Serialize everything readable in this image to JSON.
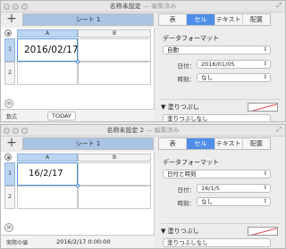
{
  "windows": [
    {
      "title": "名称未設定",
      "title_suffix": " — 編集済み",
      "sheet_tab": "シート 1",
      "inspector_tabs": [
        "表",
        "セル",
        "テキスト",
        "配置"
      ],
      "active_tab": "セル",
      "columns": [
        "A",
        "B"
      ],
      "rows": [
        "1",
        "2"
      ],
      "cell_a1": "2016/02/17",
      "formula_label": "数式",
      "formula_value": "TODAY",
      "data_format_title": "データフォーマット",
      "format_select": "自動",
      "date_label": "日付：",
      "date_value": "2016/01/05",
      "time_label": "時刻：",
      "time_value": "なし",
      "fill_label": "塗りつぶし",
      "fill_select": "塗りつぶしなし"
    },
    {
      "title": "名称未設定 2",
      "title_suffix": " — 編集済み",
      "sheet_tab": "シート 1",
      "inspector_tabs": [
        "表",
        "セル",
        "テキスト",
        "配置"
      ],
      "active_tab": "セル",
      "columns": [
        "A",
        "B"
      ],
      "rows": [
        "1",
        "2"
      ],
      "cell_a1": "16/2/17",
      "formula_label": "実際の値",
      "formula_value": "2016/2/17 0:00:00",
      "data_format_title": "データフォーマット",
      "format_select": "日付と時刻",
      "date_label": "日付：",
      "date_value": "16/1/5",
      "time_label": "時刻：",
      "time_value": "なし",
      "fill_label": "塗りつぶし",
      "fill_select": "塗りつぶしなし"
    }
  ],
  "colors": {
    "accent": "#4f8ee8",
    "selection": "#bcd5f2"
  },
  "icons": [
    "plus-icon",
    "select-all-icon",
    "equals-icon",
    "chevron-updown-icon",
    "disclosure-triangle-icon",
    "expand-icon"
  ]
}
